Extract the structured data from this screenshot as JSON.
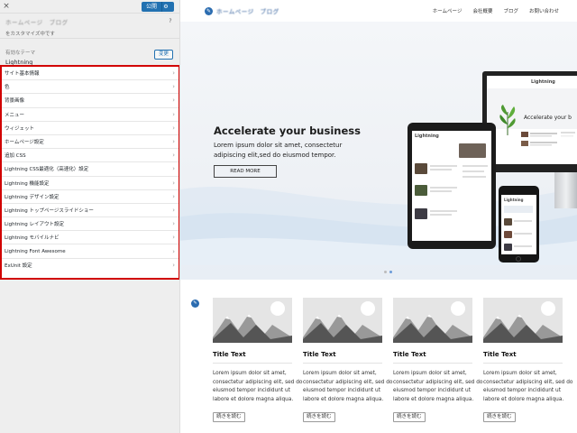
{
  "sidebar": {
    "close_icon": "×",
    "publish_label": "公開",
    "gear_icon": "⚙",
    "site_title_blurred": "ホームページ　ブログ",
    "customizing_text": "をカスタマイズ中です",
    "help_icon": "?",
    "theme_label": "有効なテーマ",
    "theme_name": "Lightning",
    "change_label": "変更",
    "chevron": "›",
    "panels": [
      {
        "label": "サイト基本情報"
      },
      {
        "label": "色"
      },
      {
        "label": "背景画像"
      },
      {
        "label": "メニュー"
      },
      {
        "label": "ウィジェット"
      },
      {
        "label": "ホームページ設定"
      },
      {
        "label": "追加 CSS"
      },
      {
        "label": "Lightning CSS最適化（高速化）設定"
      },
      {
        "label": "Lightning 機能設定"
      },
      {
        "label": "Lightning デザイン設定"
      },
      {
        "label": "Lightning トップページスライドショー"
      },
      {
        "label": "Lightning レイアウト設定"
      },
      {
        "label": "Lightning モバイルナビ"
      },
      {
        "label": "Lightning Font Awesome"
      },
      {
        "label": "ExUnit 設定"
      }
    ]
  },
  "site": {
    "logo_text": "ホームページ　ブログ",
    "nav": [
      "ホームページ",
      "会社概要",
      "ブログ",
      "お問い合わせ"
    ],
    "hero": {
      "title": "Accelerate your business",
      "line1": "Lorem ipsum dolor sit amet, consectetur",
      "line2": "adipiscing elit,sed do eiusmod tempor.",
      "button": "READ MORE"
    },
    "devices": {
      "monitor_logo": "Lightning",
      "monitor_heading": "Accelerate your b",
      "tablet_logo": "Lightning",
      "phone_logo": "Lightning"
    },
    "cards": [
      {
        "title": "Title Text",
        "line1": "Lorem ipsum dolor sit amet,",
        "line2": "consectetur adipiscing elit, sed do",
        "line3": "eiusmod tempor incididunt ut",
        "line4": "labore et dolore magna aliqua.",
        "button": "続きを読む"
      },
      {
        "title": "Title Text",
        "line1": "Lorem ipsum dolor sit amet,",
        "line2": "consectetur adipiscing elit, sed do",
        "line3": "eiusmod tempor incididunt ut",
        "line4": "labore et dolore magna aliqua.",
        "button": "続きを読む"
      },
      {
        "title": "Title Text",
        "line1": "Lorem ipsum dolor sit amet,",
        "line2": "consectetur adipiscing elit, sed do",
        "line3": "eiusmod tempor incididunt ut",
        "line4": "labore et dolore magna aliqua.",
        "button": "続きを読む"
      },
      {
        "title": "Title Text",
        "line1": "Lorem ipsum dolor sit amet,",
        "line2": "consectetur adipiscing elit, sed do",
        "line3": "eiusmod tempor incididunt ut",
        "line4": "labore et dolore magna aliqua.",
        "button": "続きを読む"
      }
    ]
  },
  "colors": {
    "publish_blue": "#2271b1",
    "highlight_red": "#d10000",
    "logo_blue": "#2b6cb0"
  }
}
